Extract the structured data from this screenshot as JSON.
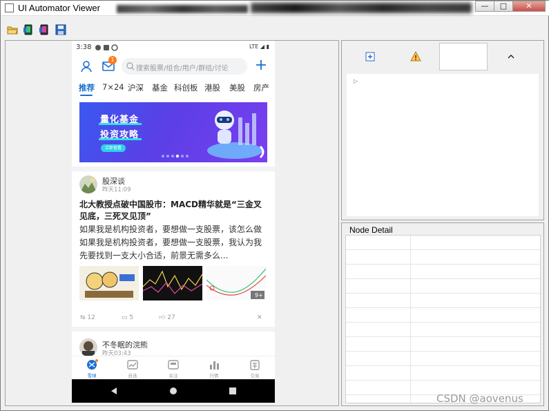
{
  "window": {
    "title": "UI Automator Viewer",
    "min_label": "—",
    "max_label": "□",
    "close_label": "✕"
  },
  "phone": {
    "status": {
      "time": "3:38",
      "right": "LTE"
    },
    "header": {
      "msg_badge": "1",
      "search_placeholder": "搜索股票/组合/用户/群组/讨论"
    },
    "tabs": [
      "推荐",
      "7×24",
      "沪深",
      "基金",
      "科创板",
      "港股",
      "美股",
      "房产"
    ],
    "banner": {
      "line1": "量化基金",
      "line2": "投资攻略",
      "button": "立即查看"
    },
    "post1": {
      "author": "股深谈",
      "time": "昨天11:09",
      "title": "北大教授点破中国股市：MACD精华就是“三金叉见底，三死叉见顶”",
      "body": "如果我是机构投资者，要想做一支股票，该怎么做 如果我是机构投资者，要想做一支股票，我认为我先要找到一支大小合适，前景无需多么...",
      "thumb3_badge": "9+",
      "reposts": "12",
      "comments": "5",
      "likes": "27"
    },
    "post2": {
      "author": "不冬眠的浣熊",
      "time": "昨天03:43"
    },
    "bottom_nav": [
      "雪球",
      "自选",
      "关注",
      "行情",
      "交易"
    ]
  },
  "detail": {
    "title": "Node Detail"
  },
  "watermark": "CSDN @aovenus",
  "colors": {
    "accent": "#1a6fd1",
    "badge": "#ff7a1a",
    "banner": "#4a4ef0"
  }
}
